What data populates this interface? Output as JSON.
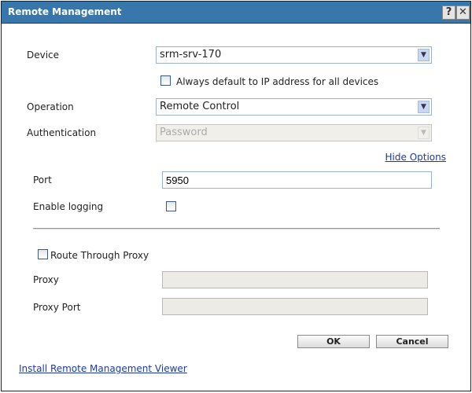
{
  "window": {
    "title": "Remote Management",
    "help_icon": "?",
    "close_icon": "✕"
  },
  "form": {
    "device_label": "Device",
    "device_value": "srm-srv-170",
    "always_default_label": "Always default to IP address for all devices",
    "always_default_checked": false,
    "operation_label": "Operation",
    "operation_value": "Remote Control",
    "authentication_label": "Authentication",
    "authentication_value": "Password",
    "hide_options": "Hide Options",
    "port_label": "Port",
    "port_value": "5950",
    "enable_logging_label": "Enable logging",
    "enable_logging_checked": false,
    "route_proxy_label": "Route Through Proxy",
    "route_proxy_checked": false,
    "proxy_label": "Proxy",
    "proxy_value": "",
    "proxy_port_label": "Proxy Port",
    "proxy_port_value": ""
  },
  "buttons": {
    "ok": "OK",
    "cancel": "Cancel"
  },
  "footer": {
    "install_viewer": "Install Remote Management Viewer"
  }
}
